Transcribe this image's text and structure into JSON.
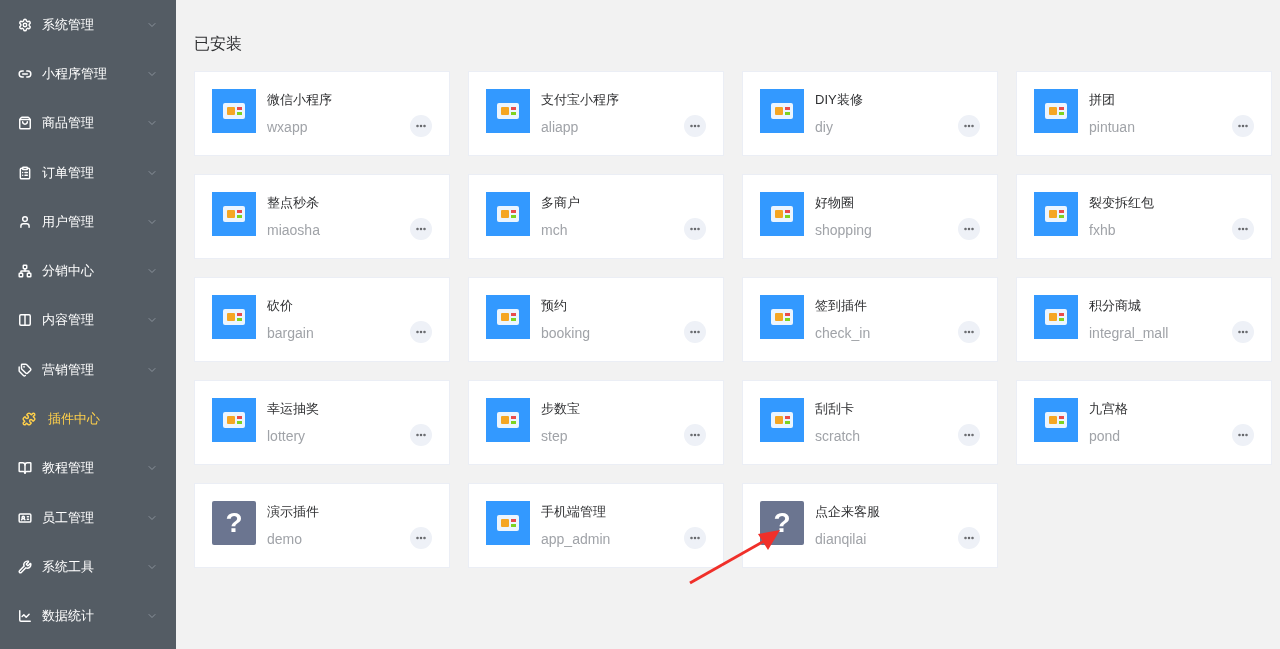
{
  "sidebar": {
    "items": [
      {
        "label": "系统管理",
        "selected": false,
        "has_submenu": true
      },
      {
        "label": "小程序管理",
        "selected": false,
        "has_submenu": true
      },
      {
        "label": "商品管理",
        "selected": false,
        "has_submenu": true
      },
      {
        "label": "订单管理",
        "selected": false,
        "has_submenu": true
      },
      {
        "label": "用户管理",
        "selected": false,
        "has_submenu": true
      },
      {
        "label": "分销中心",
        "selected": false,
        "has_submenu": true
      },
      {
        "label": "内容管理",
        "selected": false,
        "has_submenu": true
      },
      {
        "label": "营销管理",
        "selected": false,
        "has_submenu": true
      },
      {
        "label": "插件中心",
        "selected": true,
        "has_submenu": false
      },
      {
        "label": "教程管理",
        "selected": false,
        "has_submenu": true
      },
      {
        "label": "员工管理",
        "selected": false,
        "has_submenu": true
      },
      {
        "label": "系统工具",
        "selected": false,
        "has_submenu": true
      },
      {
        "label": "数据统计",
        "selected": false,
        "has_submenu": true
      }
    ]
  },
  "section_title": "已安装",
  "plugins": [
    {
      "name": "微信小程序",
      "code": "wxapp",
      "kind": "illustration"
    },
    {
      "name": "支付宝小程序",
      "code": "aliapp",
      "kind": "illustration"
    },
    {
      "name": "DIY装修",
      "code": "diy",
      "kind": "illustration"
    },
    {
      "name": "拼团",
      "code": "pintuan",
      "kind": "illustration"
    },
    {
      "name": "整点秒杀",
      "code": "miaosha",
      "kind": "illustration"
    },
    {
      "name": "多商户",
      "code": "mch",
      "kind": "illustration"
    },
    {
      "name": "好物圈",
      "code": "shopping",
      "kind": "illustration"
    },
    {
      "name": "裂变拆红包",
      "code": "fxhb",
      "kind": "illustration"
    },
    {
      "name": "砍价",
      "code": "bargain",
      "kind": "illustration"
    },
    {
      "name": "预约",
      "code": "booking",
      "kind": "illustration"
    },
    {
      "name": "签到插件",
      "code": "check_in",
      "kind": "illustration"
    },
    {
      "name": "积分商城",
      "code": "integral_mall",
      "kind": "illustration"
    },
    {
      "name": "幸运抽奖",
      "code": "lottery",
      "kind": "illustration"
    },
    {
      "name": "步数宝",
      "code": "step",
      "kind": "illustration"
    },
    {
      "name": "刮刮卡",
      "code": "scratch",
      "kind": "illustration"
    },
    {
      "name": "九宫格",
      "code": "pond",
      "kind": "illustration"
    },
    {
      "name": "演示插件",
      "code": "demo",
      "kind": "placeholder",
      "icon_text": "?"
    },
    {
      "name": "手机端管理",
      "code": "app_admin",
      "kind": "illustration"
    },
    {
      "name": "点企来客服",
      "code": "dianqilai",
      "kind": "placeholder",
      "icon_text": "?"
    }
  ],
  "annotation": {
    "kind": "arrow"
  }
}
